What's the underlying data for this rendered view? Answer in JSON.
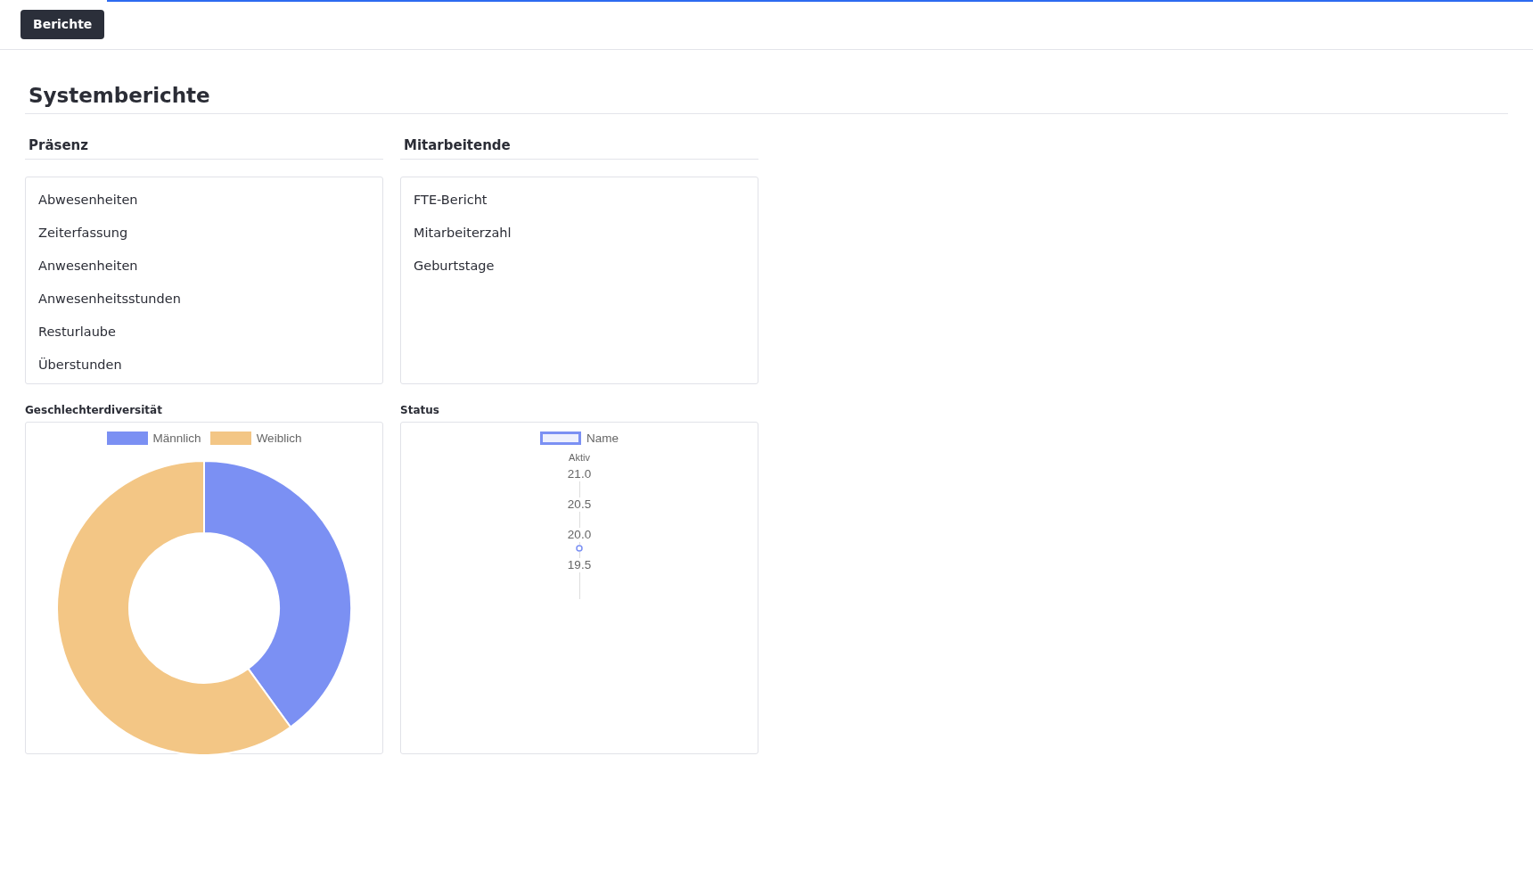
{
  "progress": {
    "level": 0.93
  },
  "toolbar": {
    "button": "Berichte"
  },
  "title": "Systemberichte",
  "sections": [
    {
      "heading": "Präsenz",
      "items": [
        "Abwesenheiten",
        "Zeiterfassung",
        "Anwesenheiten",
        "Anwesenheitsstunden",
        "Resturlaube",
        "Überstunden"
      ]
    },
    {
      "heading": "Mitarbeitende",
      "items": [
        "FTE-Bericht",
        "Mitarbeiterzahl",
        "Geburtstage"
      ]
    }
  ],
  "charts": [
    {
      "kind": "donut",
      "label": "Geschlechterdiversität",
      "legend": [
        {
          "name": "Männlich",
          "color": "#7b90f3"
        },
        {
          "name": "Weiblich",
          "color": "#f3c685"
        }
      ]
    },
    {
      "kind": "line",
      "label": "Status",
      "legend": [
        {
          "name": "Name",
          "color": "#7b90f3"
        }
      ],
      "axis_title": "Aktiv",
      "tick_labels": [
        "21.0",
        "20.5",
        "20.0",
        "19.5"
      ]
    }
  ]
}
